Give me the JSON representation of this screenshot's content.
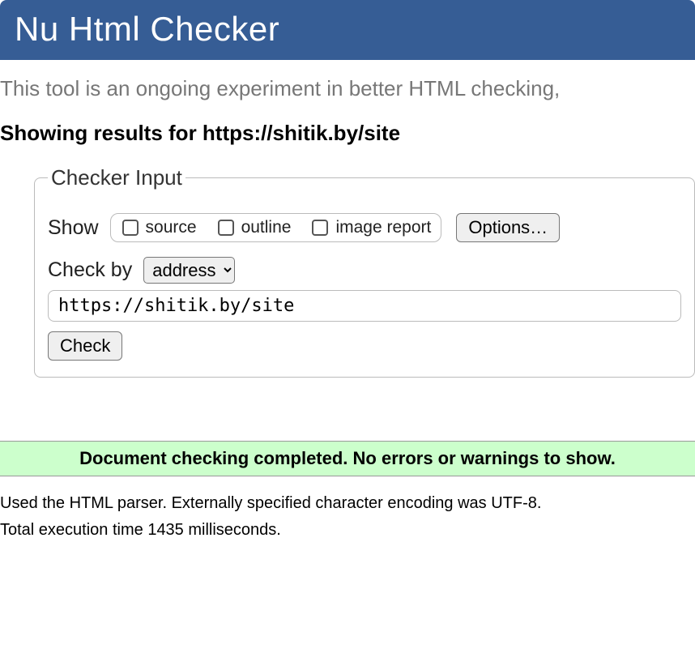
{
  "banner": {
    "title": "Nu Html Checker"
  },
  "intro": "This tool is an ongoing experiment in better HTML checking,",
  "results_for": "Showing results for https://shitik.by/site",
  "checker": {
    "legend": "Checker Input",
    "show_label": "Show",
    "checkboxes": {
      "source": "source",
      "outline": "outline",
      "image_report": "image report"
    },
    "options_button": "Options…",
    "checkby_label": "Check by",
    "checkby_select": {
      "selected": "address"
    },
    "url_value": "https://shitik.by/site",
    "check_button": "Check"
  },
  "result": {
    "success_message": "Document checking completed. No errors or warnings to show.",
    "parser_info": "Used the HTML parser. Externally specified character encoding was UTF-8.",
    "exec_time": "Total execution time 1435 milliseconds."
  }
}
